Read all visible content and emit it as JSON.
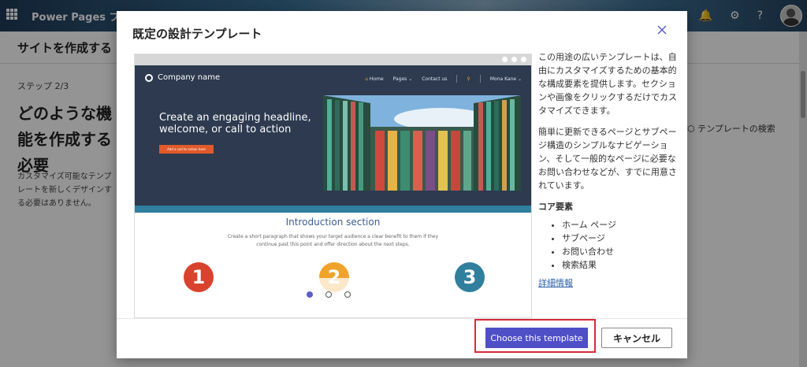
{
  "app": {
    "title": "Power Pages プレ",
    "subheader_title": "サイトを作成する",
    "step": "ステップ 2/3",
    "heading": "どのような機能を作成する必要",
    "description": "カスタマイズ可能なテンプレートを新しくデザインする必要はありません。",
    "template_search": "テンプレートの検索"
  },
  "dialog": {
    "title": "既定の設計テンプレート",
    "preview": {
      "company_name": "Company name",
      "nav": [
        "Home",
        "Pages",
        "Contact us"
      ],
      "user": "Mona Kane",
      "headline": "Create an engaging headline, welcome, or call to action",
      "cta": "Add a call to action here",
      "intro_title": "Introduction section",
      "intro_text": "Create a short paragraph that shows your target audience a clear benefit to them if they continue past this point and offer direction about the next steps.",
      "numbers": [
        "1",
        "2",
        "3"
      ],
      "carousel_count": 3,
      "carousel_active": 1
    },
    "description_p1": "この用途の広いテンプレートは、自由にカスタマイズするための基本的な構成要素を提供します。セクションや画像をクリックするだけでカスタマイズできます。",
    "description_p2": "簡単に更新できるページとサブページ構造のシンプルなナビゲーション、そして一般的なページに必要なお問い合わせなどが、すでに用意されています。",
    "core_title": "コア要素",
    "core_items": [
      "ホーム ページ",
      "サブページ",
      "お問い合わせ",
      "検索結果"
    ],
    "more_link": "詳細情報",
    "choose_label": "Choose this template",
    "cancel_label": "キャンセル"
  },
  "colors": {
    "accent": "#4f4fc7",
    "highlight_border": "#d62b3a",
    "hero_bg": "#2d3a4f"
  }
}
